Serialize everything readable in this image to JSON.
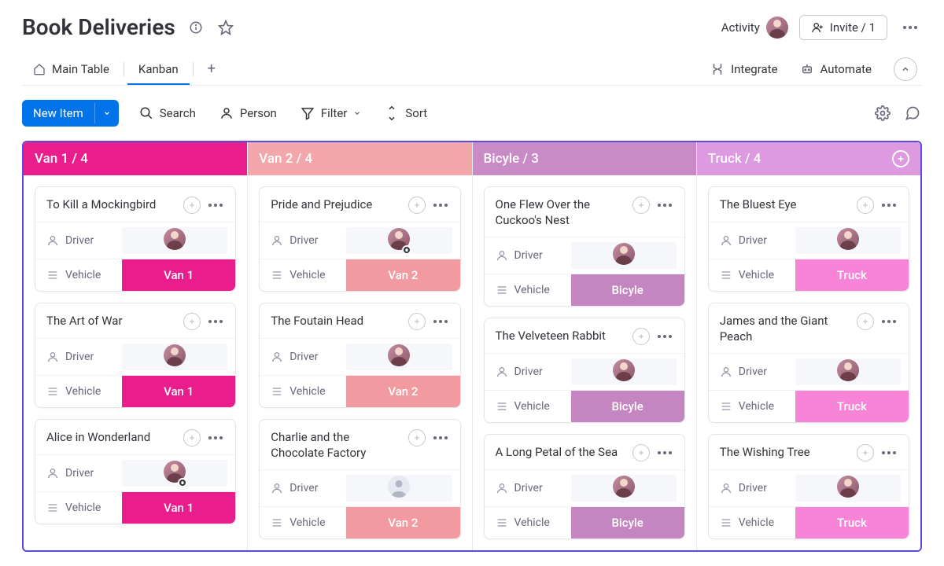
{
  "header": {
    "title": "Book Deliveries",
    "activity_label": "Activity",
    "invite_label": "Invite / 1"
  },
  "tabs": {
    "items": [
      {
        "label": "Main Table"
      },
      {
        "label": "Kanban"
      }
    ],
    "active_index": 1,
    "integrate": "Integrate",
    "automate": "Automate"
  },
  "toolbar": {
    "new_item": "New Item",
    "search": "Search",
    "person": "Person",
    "filter": "Filter",
    "sort": "Sort"
  },
  "colors": {
    "van1": "#e91e8c",
    "van1_light": "#f29bbd",
    "van2": "#f19aa0",
    "van2_dark": "#f19aa0",
    "bicyle": "#c386c1",
    "bicyle_dark": "#c386c1",
    "truck": "#d48cd8",
    "truck_chip": "#f784d6"
  },
  "columns": [
    {
      "header_label": "Van 1 / 4",
      "header_bg": "#e91e8c",
      "cards": [
        {
          "title": "To Kill a Mockingbird",
          "driver_avatar": "user",
          "driver_badge": false,
          "chip_label": "Van 1",
          "chip_bg": "#e91e8c",
          "row_driver": "Driver",
          "row_vehicle": "Vehicle"
        },
        {
          "title": "The Art of War",
          "driver_avatar": "user",
          "driver_badge": false,
          "chip_label": "Van 1",
          "chip_bg": "#e91e8c",
          "row_driver": "Driver",
          "row_vehicle": "Vehicle"
        },
        {
          "title": "Alice in Wonderland",
          "driver_avatar": "user",
          "driver_badge": true,
          "chip_label": "Van 1",
          "chip_bg": "#e91e8c",
          "row_driver": "Driver",
          "row_vehicle": "Vehicle"
        }
      ]
    },
    {
      "header_label": "Van 2 / 4",
      "header_bg": "#f3a7ab",
      "header_text": "#ffffff",
      "cards": [
        {
          "title": "Pride and Prejudice",
          "driver_avatar": "user",
          "driver_badge": true,
          "chip_label": "Van 2",
          "chip_bg": "#f19aa0",
          "row_driver": "Driver",
          "row_vehicle": "Vehicle"
        },
        {
          "title": "The Foutain Head",
          "driver_avatar": "user",
          "driver_badge": false,
          "chip_label": "Van 2",
          "chip_bg": "#f19aa0",
          "row_driver": "Driver",
          "row_vehicle": "Vehicle"
        },
        {
          "title": "Charlie and the Chocolate Factory",
          "driver_avatar": "generic",
          "driver_badge": false,
          "chip_label": "Van 2",
          "chip_bg": "#f19aa0",
          "row_driver": "Driver",
          "row_vehicle": "Vehicle"
        }
      ]
    },
    {
      "header_label": "Bicyle / 3",
      "header_bg": "#c88bc6",
      "cards": [
        {
          "title": "One Flew Over the Cuckoo's Nest",
          "driver_avatar": "user",
          "driver_badge": false,
          "chip_label": "Bicyle",
          "chip_bg": "#c386c1",
          "row_driver": "Driver",
          "row_vehicle": "Vehicle"
        },
        {
          "title": "The Velveteen Rabbit",
          "driver_avatar": "user",
          "driver_badge": false,
          "chip_label": "Bicyle",
          "chip_bg": "#c386c1",
          "row_driver": "Driver",
          "row_vehicle": "Vehicle"
        },
        {
          "title": "A Long Petal of the Sea",
          "driver_avatar": "user",
          "driver_badge": false,
          "chip_label": "Bicyle",
          "chip_bg": "#c386c1",
          "row_driver": "Driver",
          "row_vehicle": "Vehicle"
        }
      ]
    },
    {
      "header_label": "Truck / 4",
      "header_bg": "#dd9ae0",
      "show_add": true,
      "cards": [
        {
          "title": "The Bluest Eye",
          "driver_avatar": "user",
          "driver_badge": false,
          "chip_label": "Truck",
          "chip_bg": "#f784d6",
          "row_driver": "Driver",
          "row_vehicle": "Vehicle"
        },
        {
          "title": "James and the Giant Peach",
          "driver_avatar": "user",
          "driver_badge": false,
          "chip_label": "Truck",
          "chip_bg": "#f784d6",
          "row_driver": "Driver",
          "row_vehicle": "Vehicle"
        },
        {
          "title": "The Wishing Tree",
          "driver_avatar": "user",
          "driver_badge": false,
          "chip_label": "Truck",
          "chip_bg": "#f784d6",
          "row_driver": "Driver",
          "row_vehicle": "Vehicle"
        }
      ]
    }
  ]
}
